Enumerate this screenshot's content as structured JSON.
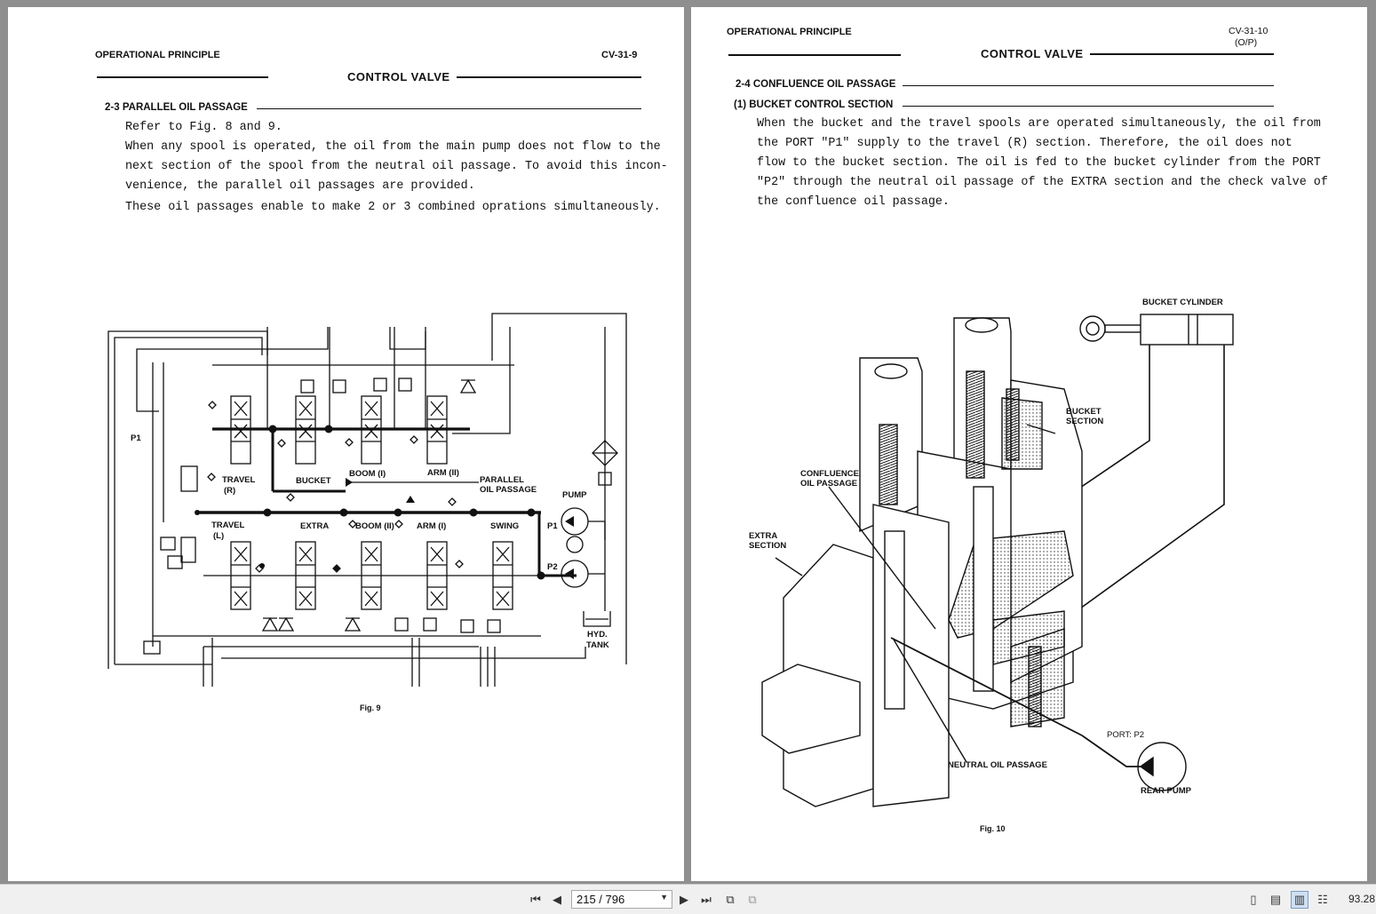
{
  "left_page": {
    "header_left": "OPERATIONAL PRINCIPLE",
    "header_right": "CV-31-9",
    "section_title": "CONTROL VALVE",
    "subsection": "2-3  PARALLEL OIL PASSAGE",
    "paragraph_lines": [
      "Refer to Fig. 8 and 9.",
      "When any spool is operated, the oil from the main pump does not flow to the",
      "next section of the spool from the neutral oil passage. To avoid this incon-",
      "venience, the parallel oil passages are provided.",
      "These oil passages enable to make 2 or 3 combined oprations simultaneously."
    ],
    "figure": {
      "caption": "Fig. 9",
      "labels": {
        "p1_left": "P1",
        "travel_r_1": "TRAVEL",
        "travel_r_2": "(R)",
        "bucket": "BUCKET",
        "boom1": "BOOM (I)",
        "arm2": "ARM (II)",
        "parallel_1": "PARALLEL",
        "parallel_2": "OIL PASSAGE",
        "pump": "PUMP",
        "travel_l_1": "TRAVEL",
        "travel_l_2": "(L)",
        "extra": "EXTRA",
        "boom2": "BOOM (II)",
        "arm1": "ARM (I)",
        "swing": "SWING",
        "p1_right": "P1",
        "p2_right": "P2",
        "hyd": "HYD.",
        "tank": "TANK"
      }
    }
  },
  "right_page": {
    "header_left": "OPERATIONAL PRINCIPLE",
    "header_right_1": "CV-31-10",
    "header_right_2": "(O/P)",
    "section_title": "CONTROL VALVE",
    "subsection": "2-4  CONFLUENCE OIL PASSAGE",
    "subsubsection": "(1)  BUCKET CONTROL SECTION",
    "paragraph_lines": [
      "When the bucket and the travel spools are operated simultaneously, the oil from",
      "the PORT \"P1\" supply to the travel (R) section.  Therefore, the oil does not",
      "flow to the bucket section.  The oil is fed to the bucket cylinder from the PORT",
      "\"P2\" through the neutral oil passage of the EXTRA section and the check valve of",
      "the confluence oil passage."
    ],
    "figure": {
      "caption": "Fig. 10",
      "labels": {
        "bucket_cylinder": "BUCKET CYLINDER",
        "bucket_section_1": "BUCKET",
        "bucket_section_2": "SECTION",
        "confluence_1": "CONFLUENCE",
        "confluence_2": "OIL PASSAGE",
        "extra_1": "EXTRA",
        "extra_2": "SECTION",
        "port_p2": "PORT: P2",
        "neutral": "NEUTRAL OIL PASSAGE",
        "rear_pump": "REAR PUMP"
      }
    }
  },
  "toolbar": {
    "page_indicator": "215 / 796",
    "zoom": "93.28"
  }
}
